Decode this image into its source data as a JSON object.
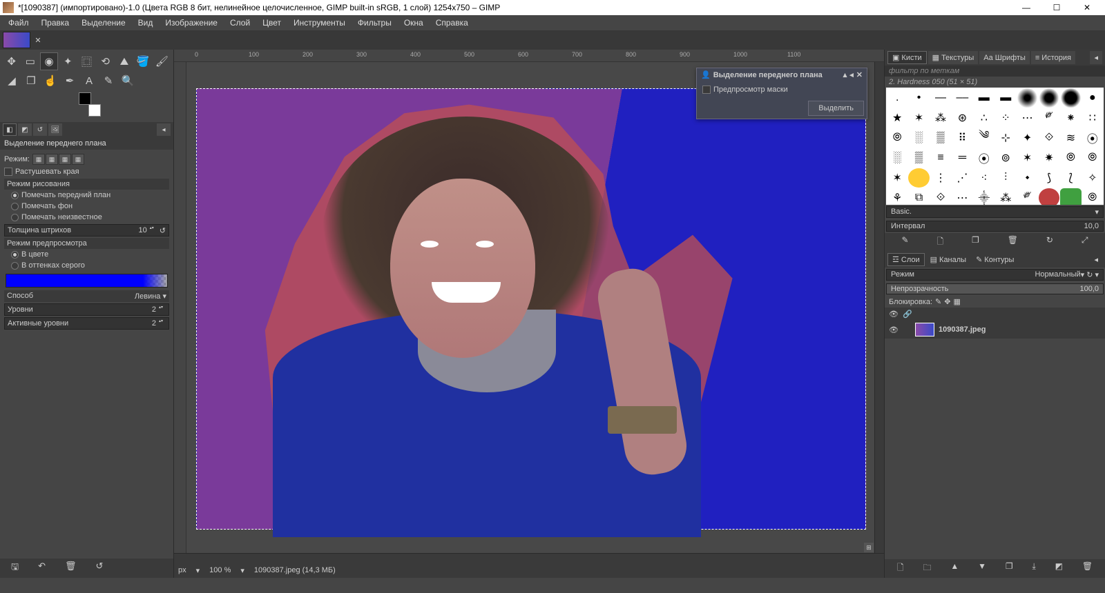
{
  "title": "*[1090387] (импортировано)-1.0 (Цвета RGB 8 бит, нелинейное целочисленное, GIMP built-in sRGB, 1 слой) 1254x750 – GIMP",
  "menu": [
    "Файл",
    "Правка",
    "Выделение",
    "Вид",
    "Изображение",
    "Слой",
    "Цвет",
    "Инструменты",
    "Фильтры",
    "Окна",
    "Справка"
  ],
  "toolopt": {
    "title": "Выделение переднего плана",
    "mode_label": "Режим:",
    "feather": "Растушевать края",
    "draw_section": "Режим рисования",
    "draw_fg": "Помечать передний план",
    "draw_bg": "Помечать фон",
    "draw_unknown": "Помечать неизвестное",
    "stroke_label": "Толщина штрихов",
    "stroke_val": "10",
    "preview_section": "Режим предпросмотра",
    "preview_color": "В цвете",
    "preview_gray": "В оттенках серого",
    "method_label": "Способ",
    "method_val": "Левина",
    "levels_label": "Уровни",
    "levels_val": "2",
    "active_label": "Активные уровни",
    "active_val": "2"
  },
  "dialog": {
    "title": "Выделение переднего плана",
    "mask_preview": "Предпросмотр маски",
    "select_btn": "Выделить"
  },
  "right": {
    "tabs": [
      "Кисти",
      "Текстуры",
      "Шрифты",
      "История"
    ],
    "filter_placeholder": "фильтр по меткам",
    "brush_label": "2. Hardness 050 (51 × 51)",
    "basic": "Basic.",
    "interval_label": "Интервал",
    "interval_val": "10,0",
    "tabs2": [
      "Слои",
      "Каналы",
      "Контуры"
    ],
    "blend_label": "Режим",
    "blend_val": "Нормальный",
    "opacity_label": "Непрозрачность",
    "opacity_val": "100,0",
    "lock_label": "Блокировка:",
    "layer_name": "1090387.jpeg"
  },
  "status": {
    "unit": "px",
    "zoom": "100 %",
    "file": "1090387.jpeg (14,3 МБ)"
  },
  "ruler_marks": [
    "0",
    "100",
    "200",
    "300",
    "400",
    "500",
    "600",
    "700",
    "800",
    "900",
    "1000",
    "1100"
  ]
}
